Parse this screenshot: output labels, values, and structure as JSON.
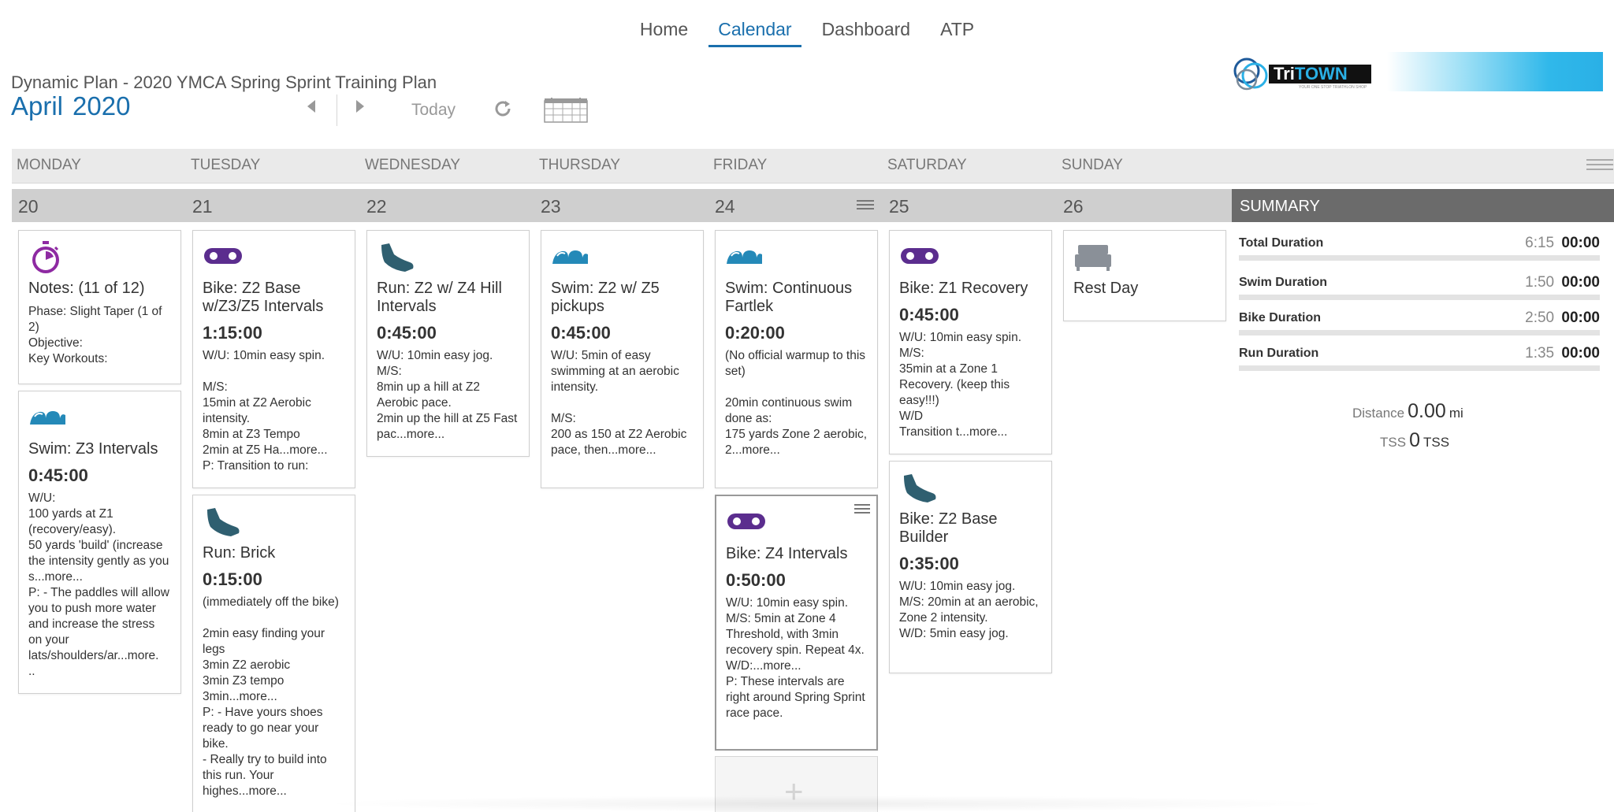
{
  "nav": [
    "Home",
    "Calendar",
    "Dashboard",
    "ATP"
  ],
  "nav_active": "Calendar",
  "header": {
    "plan_title": "Dynamic Plan - 2020 YMCA Spring Sprint Training Plan",
    "month": "April",
    "year": "2020",
    "today_label": "Today"
  },
  "logo": {
    "brand_a": "Tri",
    "brand_b": "TOWN",
    "tagline": "YOUR ONE STOP TRIATHLON SHOP"
  },
  "weekdays": [
    "MONDAY",
    "TUESDAY",
    "WEDNESDAY",
    "THURSDAY",
    "FRIDAY",
    "SATURDAY",
    "SUNDAY"
  ],
  "day_numbers": [
    "20",
    "21",
    "22",
    "23",
    "24",
    "25",
    "26"
  ],
  "colors": {
    "accent": "#1a6fad",
    "swim": "#2489b8",
    "bike": "#5b2d8e",
    "run": "#2f5f70",
    "notes": "#8e2aa2"
  },
  "cards": [
    {
      "icon": "stopwatch-icon",
      "title": "Notes: (11 of 12)",
      "duration": "",
      "body": "",
      "sub": "Phase: Slight Taper (1 of 2)\nObjective:\nKey Workouts:"
    },
    {
      "icon": "swim-wave-icon",
      "title": "Swim: Z3 Intervals",
      "duration": "0:45:00",
      "body": "W/U:\n100 yards at Z1 (recovery/easy).\n50 yards 'build' (increase the intensity gently as you s...more...\nP: - The paddles will allow you to push more water and increase the stress on your lats/shoulders/ar...more.\n.."
    },
    {
      "icon": "bike-chain-icon",
      "title": "Bike: Z2 Base w/Z3/Z5 Intervals",
      "duration": "1:15:00",
      "body": "W/U: 10min easy spin.\n\nM/S:\n15min at Z2 Aerobic intensity.\n8min at Z3 Tempo\n2min at Z5 Ha...more...\nP: Transition to run:"
    },
    {
      "icon": "run-shoe-icon",
      "title": "Run: Brick",
      "duration": "0:15:00",
      "body": "(immediately off the bike)\n\n2min easy finding your legs\n3min Z2 aerobic\n3min Z3 tempo\n3min...more...\nP: - Have yours shoes ready to go near your bike.\n- Really try to build into this run. Your highes...more..."
    },
    {
      "icon": "run-shoe-icon",
      "title": "Run: Z2 w/ Z4 Hill Intervals",
      "duration": "0:45:00",
      "body": "W/U: 10min easy jog.\nM/S:\n8min up a hill at Z2 Aerobic pace.\n2min up the hill at Z5 Fast pac...more..."
    },
    {
      "icon": "swim-wave-icon",
      "title": "Swim: Z2 w/ Z5 pickups",
      "duration": "0:45:00",
      "body": "W/U: 5min of easy swimming at an aerobic intensity.\n\nM/S:\n200 as 150 at Z2 Aerobic pace, then...more..."
    },
    {
      "icon": "swim-wave-icon",
      "title": "Swim: Continuous Fartlek",
      "duration": "0:20:00",
      "body": "(No official warmup to this set)\n\n20min continuous swim done as:\n175 yards Zone 2 aerobic,\n2...more..."
    },
    {
      "icon": "bike-chain-icon",
      "title": "Bike: Z4 Intervals",
      "duration": "0:50:00",
      "body": "W/U: 10min easy spin.\nM/S: 5min at Zone 4 Threshold, with 3min recovery spin. Repeat 4x.\nW/D:...more...\nP: These intervals are right around Spring Sprint race pace."
    },
    {
      "icon": "bike-chain-icon",
      "title": "Bike: Z1 Recovery",
      "duration": "0:45:00",
      "body": "W/U: 10min easy spin.\nM/S:\n35min at a Zone 1 Recovery. (keep this easy!!!)\nW/D\nTransition t...more..."
    },
    {
      "icon": "run-shoe-icon",
      "title": "Bike: Z2 Base Builder",
      "duration": "0:35:00",
      "body": "W/U: 10min easy jog.\nM/S: 20min at an aerobic, Zone 2 intensity.\nW/D: 5min easy jog."
    },
    {
      "icon": "bed-icon",
      "title": "Rest Day",
      "duration": "",
      "body": ""
    }
  ],
  "summary": {
    "title": "SUMMARY",
    "rows": [
      {
        "label": "Total Duration",
        "planned": "6:15",
        "actual": "00:00"
      },
      {
        "label": "Swim Duration",
        "planned": "1:50",
        "actual": "00:00"
      },
      {
        "label": "Bike Duration",
        "planned": "2:50",
        "actual": "00:00"
      },
      {
        "label": "Run Duration",
        "planned": "1:35",
        "actual": "00:00"
      }
    ],
    "distance_label": "Distance",
    "distance_value": "0.00",
    "distance_unit": "mi",
    "tss_label": "TSS",
    "tss_value": "0",
    "tss_unit": "TSS"
  }
}
